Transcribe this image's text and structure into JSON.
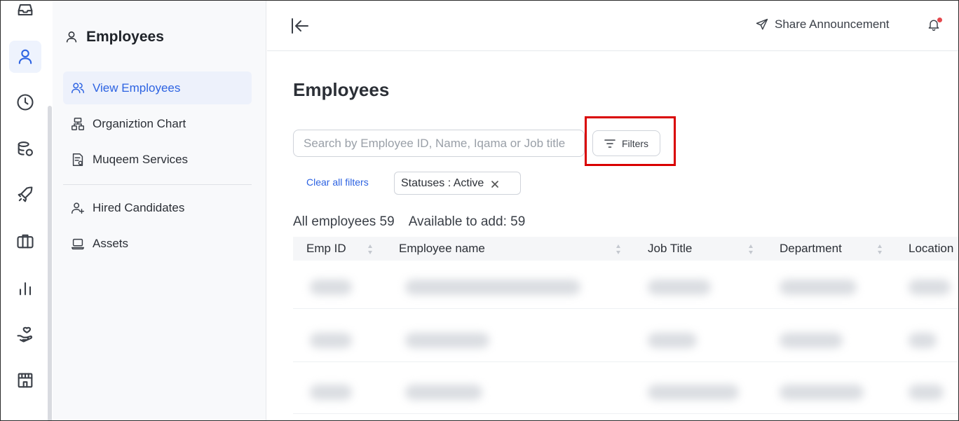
{
  "rail": {
    "icons": [
      "inbox-icon",
      "user-icon",
      "clock-icon",
      "database-icon",
      "rocket-icon",
      "briefcase-icon",
      "bar-chart-icon",
      "hand-heart-icon",
      "building-icon"
    ]
  },
  "sidebar": {
    "title": "Employees",
    "items": [
      {
        "label": "View Employees",
        "icon": "users-icon",
        "active": true
      },
      {
        "label": "Organiztion Chart",
        "icon": "org-chart-icon",
        "active": false
      },
      {
        "label": "Muqeem Services",
        "icon": "document-icon",
        "active": false
      },
      {
        "label": "Hired Candidates",
        "icon": "user-plus-icon",
        "active": false
      },
      {
        "label": "Assets",
        "icon": "laptop-icon",
        "active": false
      }
    ]
  },
  "topbar": {
    "share_label": "Share Announcement"
  },
  "main": {
    "title": "Employees",
    "search": {
      "placeholder": "Search by Employee ID, Name, Iqama or Job title",
      "value": ""
    },
    "filters_label": "Filters",
    "clear_filters_label": "Clear all filters",
    "chip_label": "Statuses : Active",
    "all_employees_label": "All employees 59",
    "available_label": "Available to add: 59",
    "columns": [
      "Emp ID",
      "Employee name",
      "Job Title",
      "Department",
      "Location"
    ]
  },
  "colors": {
    "accent": "#2d63e2",
    "highlight": "#d90000",
    "notification": "#e5484d"
  }
}
